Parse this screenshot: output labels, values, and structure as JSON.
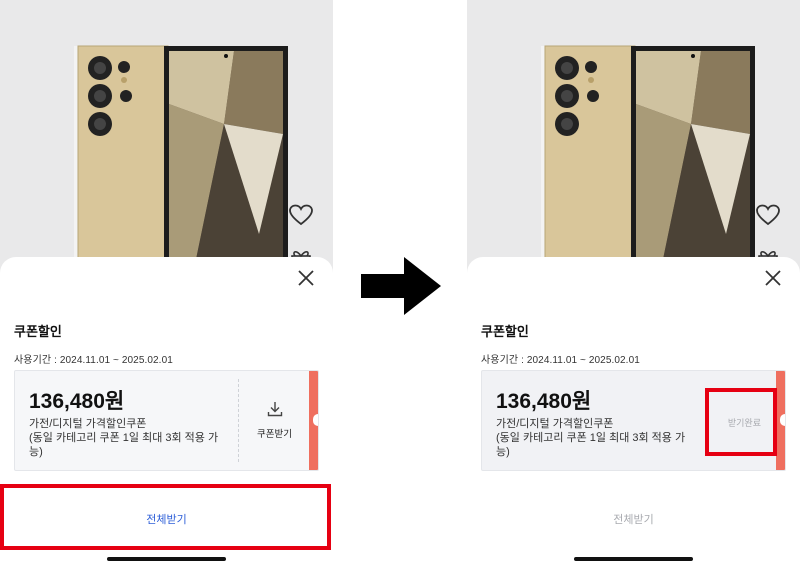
{
  "before": {
    "sheet_title": "쿠폰할인",
    "period": "사용기간 : 2024.11.01 ~ 2025.02.01",
    "coupon": {
      "amount": "136,480원",
      "name": "가전/디지털 가격할인쿠폰",
      "condition": "(동일 카테고리 쿠폰 1일 최대 3회 적용 가능)",
      "action_label": "쿠폰받기"
    },
    "all_button": "전체받기"
  },
  "after": {
    "sheet_title": "쿠폰할인",
    "period": "사용기간 : 2024.11.01 ~ 2025.02.01",
    "coupon": {
      "amount": "136,480원",
      "name": "가전/디지털 가격할인쿠폰",
      "condition": "(동일 카테고리 쿠폰 1일 최대 3회 적용 가능)",
      "action_label": "받기완료"
    },
    "all_button": "전체받기"
  },
  "icons": {
    "close": "close-icon",
    "download": "download-icon",
    "heart": "heart-icon",
    "gift": "gift-icon",
    "arrow": "right-arrow-icon"
  },
  "colors": {
    "highlight": "#e60012",
    "coupon_edge": "#ef6f5f",
    "all_button_active": "#2e5fd8",
    "all_button_inactive": "#a9abb0",
    "phone_gold": "#d6c49a"
  }
}
